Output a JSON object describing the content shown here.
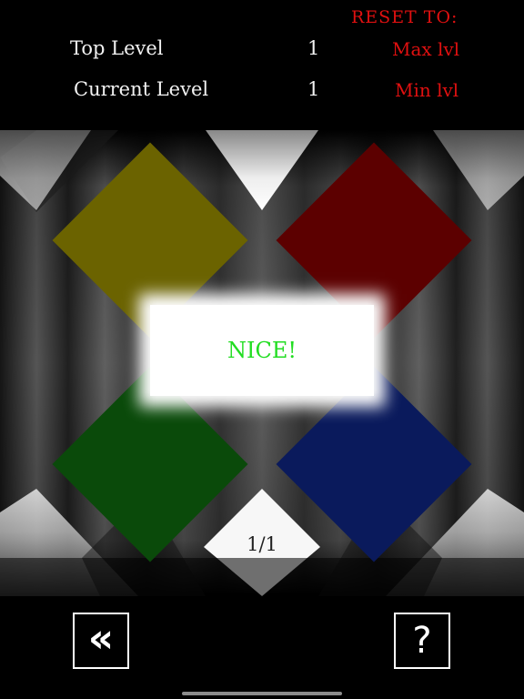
{
  "header": {
    "reset_title": "RESET TO:",
    "top_level_label": "Top Level",
    "top_level_value": "1",
    "current_level_label": "Current Level",
    "current_level_value": "1",
    "reset_max_label": "Max lvl",
    "reset_min_label": "Min lvl"
  },
  "board": {
    "tiles": [
      {
        "name": "yellow",
        "color": "#6b6300"
      },
      {
        "name": "red",
        "color": "#5c0000"
      },
      {
        "name": "green",
        "color": "#0a4a0a"
      },
      {
        "name": "blue",
        "color": "#0a1a5c"
      }
    ],
    "message": "NICE!",
    "message_color": "#22dd22",
    "counter": "1/1"
  },
  "footer": {
    "back_label": "«",
    "help_label": "?"
  },
  "colors": {
    "accent_red": "#e01010",
    "background": "#000000"
  }
}
